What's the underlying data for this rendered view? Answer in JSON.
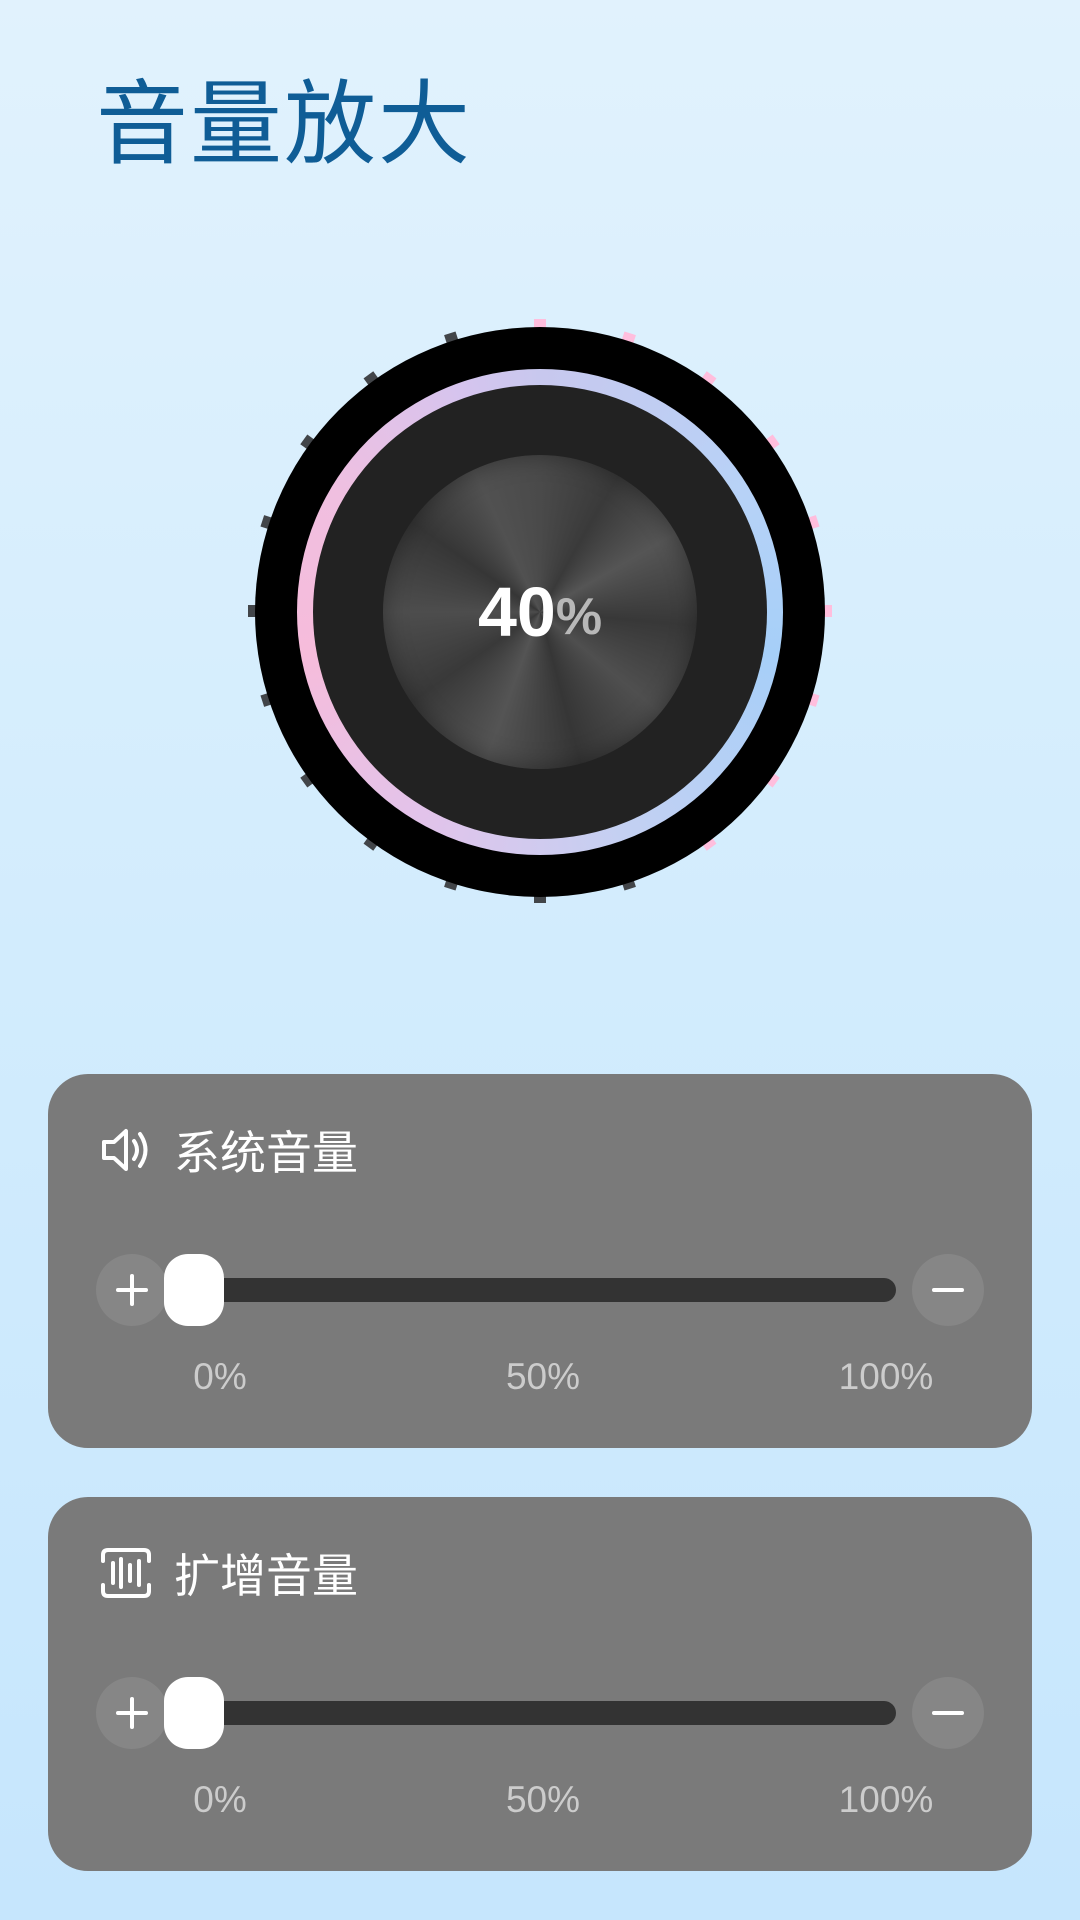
{
  "page": {
    "title": "音量放大"
  },
  "knob": {
    "value": "40",
    "unit": "%",
    "level_percent": 40,
    "tick_count": 20,
    "active_tick_color": "#ffbedd",
    "inactive_tick_color": "#424549"
  },
  "colors": {
    "title": "#0f5d96",
    "card_background": "#7a7a7a",
    "slider_track": "#333333",
    "slider_thumb": "#ffffff"
  },
  "system_volume": {
    "title": "系统音量",
    "icon": "speaker-icon",
    "plus_icon": "plus-icon",
    "minus_icon": "minus-icon",
    "level_percent": 0,
    "labels": [
      "0%",
      "50%",
      "100%"
    ]
  },
  "boost_volume": {
    "title": "扩增音量",
    "icon": "equalizer-icon",
    "plus_icon": "plus-icon",
    "minus_icon": "minus-icon",
    "level_percent": 0,
    "labels": [
      "0%",
      "50%",
      "100%"
    ]
  }
}
